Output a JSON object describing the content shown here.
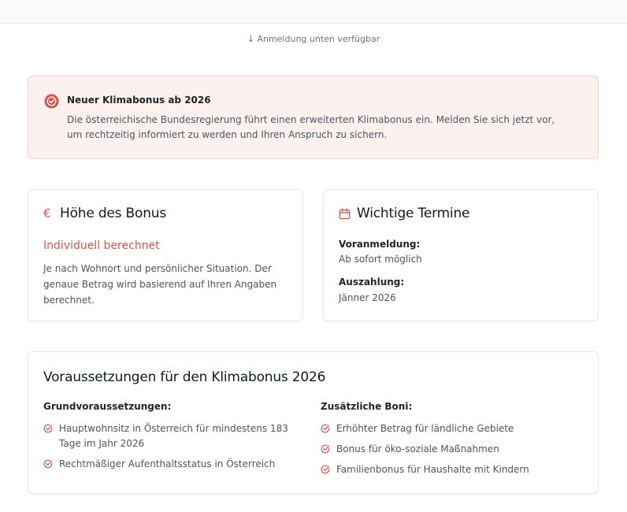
{
  "status_line": "↓ Anmeldung unten verfügbar",
  "alert": {
    "icon": "check-circle-icon",
    "title": "Neuer Klimabonus ab 2026",
    "text": "Die österreichische Bundesregierung führt einen erweiterten Klimabonus ein. Melden Sie sich jetzt vor, um rechtzeitig informiert zu werden und Ihren Anspruch zu sichern."
  },
  "bonus_card": {
    "icon": "€",
    "title": "Höhe des Bonus",
    "highlight": "Individuell berechnet",
    "text": "Je nach Wohnort und persönlicher Situation. Der genaue Betrag wird basierend auf Ihren Angaben berechnet."
  },
  "dates_card": {
    "icon": "calendar-icon",
    "title": "Wichtige Termine",
    "items": [
      {
        "label": "Voranmeldung:",
        "value": "Ab sofort möglich"
      },
      {
        "label": "Auszahlung:",
        "value": "Jänner 2026"
      }
    ]
  },
  "requirements": {
    "title": "Voraussetzungen für den Klimabonus 2026",
    "basic": {
      "heading": "Grundvoraussetzungen:",
      "items": [
        "Hauptwohnsitz in Österreich für mindestens 183 Tage im Jahr 2026",
        "Rechtmäßiger Aufenthaltsstatus in Österreich"
      ]
    },
    "extra": {
      "heading": "Zusätzliche Boni:",
      "items": [
        "Erhöhter Betrag für ländliche Gebiete",
        "Bonus für öko-soziale Maßnahmen",
        "Familienbonus für Haushalte mit Kindern"
      ]
    }
  },
  "colors": {
    "accent": "#d9534f",
    "alert_bg": "#fdf1ef",
    "alert_border": "#f5d3cc"
  }
}
